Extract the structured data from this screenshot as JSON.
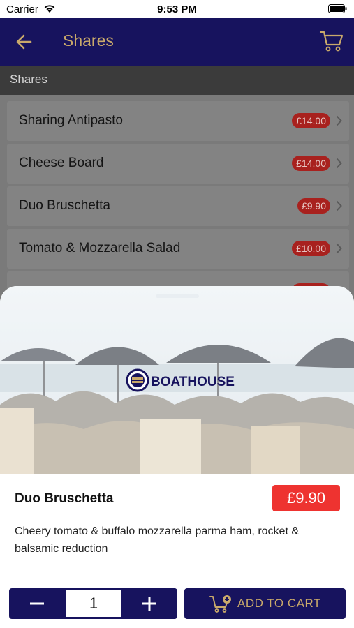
{
  "status_bar": {
    "carrier": "Carrier",
    "time": "9:53 PM"
  },
  "header": {
    "title": "Shares"
  },
  "section": {
    "title": "Shares"
  },
  "menu": {
    "items": [
      {
        "name": "Sharing Antipasto",
        "price": "£14.00"
      },
      {
        "name": "Cheese Board",
        "price": "£14.00"
      },
      {
        "name": "Duo Bruschetta",
        "price": "£9.90"
      },
      {
        "name": "Tomato & Mozzarella Salad",
        "price": "£10.00"
      }
    ]
  },
  "detail": {
    "logo_text": "BOATHOUSE",
    "title": "Duo Bruschetta",
    "price": "£9.90",
    "description": "Cheery tomato & buffalo mozzarella parma ham, rocket & balsamic reduction",
    "quantity": "1",
    "add_to_cart_label": "ADD TO CART"
  },
  "colors": {
    "brand_navy": "#17135e",
    "brand_gold": "#c9a96b",
    "price_red": "#ee3330"
  }
}
